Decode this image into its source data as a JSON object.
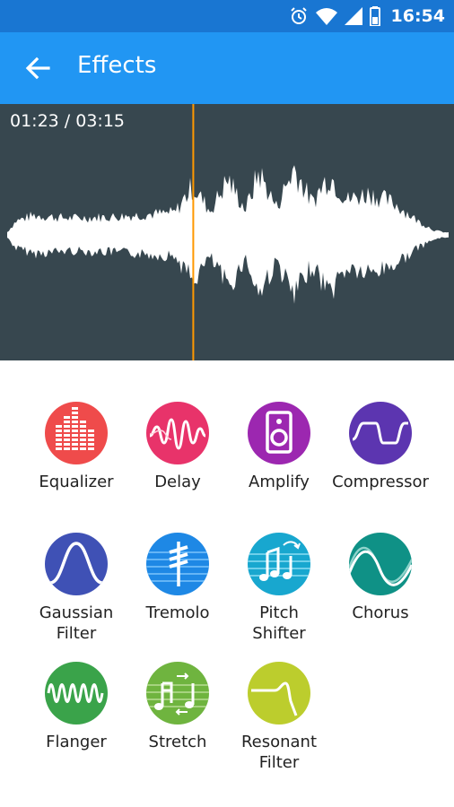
{
  "status": {
    "time": "16:54",
    "icons": [
      "alarm-icon",
      "wifi-icon",
      "signal-icon",
      "battery-icon"
    ]
  },
  "appbar": {
    "title": "Effects",
    "back_icon": "arrow-back-icon"
  },
  "player": {
    "position": "01:23",
    "duration": "03:15",
    "time_readout": "01:23 / 03:15",
    "playhead_color": "#ff9800"
  },
  "colors": {
    "statusbar": "#1976d2",
    "appbar": "#2196f3",
    "waveform_bg": "#37474f"
  },
  "effects": [
    {
      "label": "Equalizer",
      "icon": "equalizer-icon",
      "color": "#ef4b4b"
    },
    {
      "label": "Delay",
      "icon": "delay-icon",
      "color": "#e8336a"
    },
    {
      "label": "Amplify",
      "icon": "speaker-icon",
      "color": "#9c27b0"
    },
    {
      "label": "Compressor",
      "icon": "compressor-icon",
      "color": "#5c35b0"
    },
    {
      "label": "Gaussian\nFilter",
      "icon": "gaussian-curve-icon",
      "color": "#3f51b5"
    },
    {
      "label": "Tremolo",
      "icon": "tremolo-icon",
      "color": "#1e88e5"
    },
    {
      "label": "Pitch\nShifter",
      "icon": "music-notes-icon",
      "color": "#18a7cf"
    },
    {
      "label": "Chorus",
      "icon": "chorus-wave-icon",
      "color": "#0f9186"
    },
    {
      "label": "Flanger",
      "icon": "flanger-wave-icon",
      "color": "#3aa34a"
    },
    {
      "label": "Stretch",
      "icon": "stretch-notes-icon",
      "color": "#6fb43f"
    },
    {
      "label": "Resonant\nFilter",
      "icon": "resonant-filter-icon",
      "color": "#bccd2d"
    }
  ]
}
